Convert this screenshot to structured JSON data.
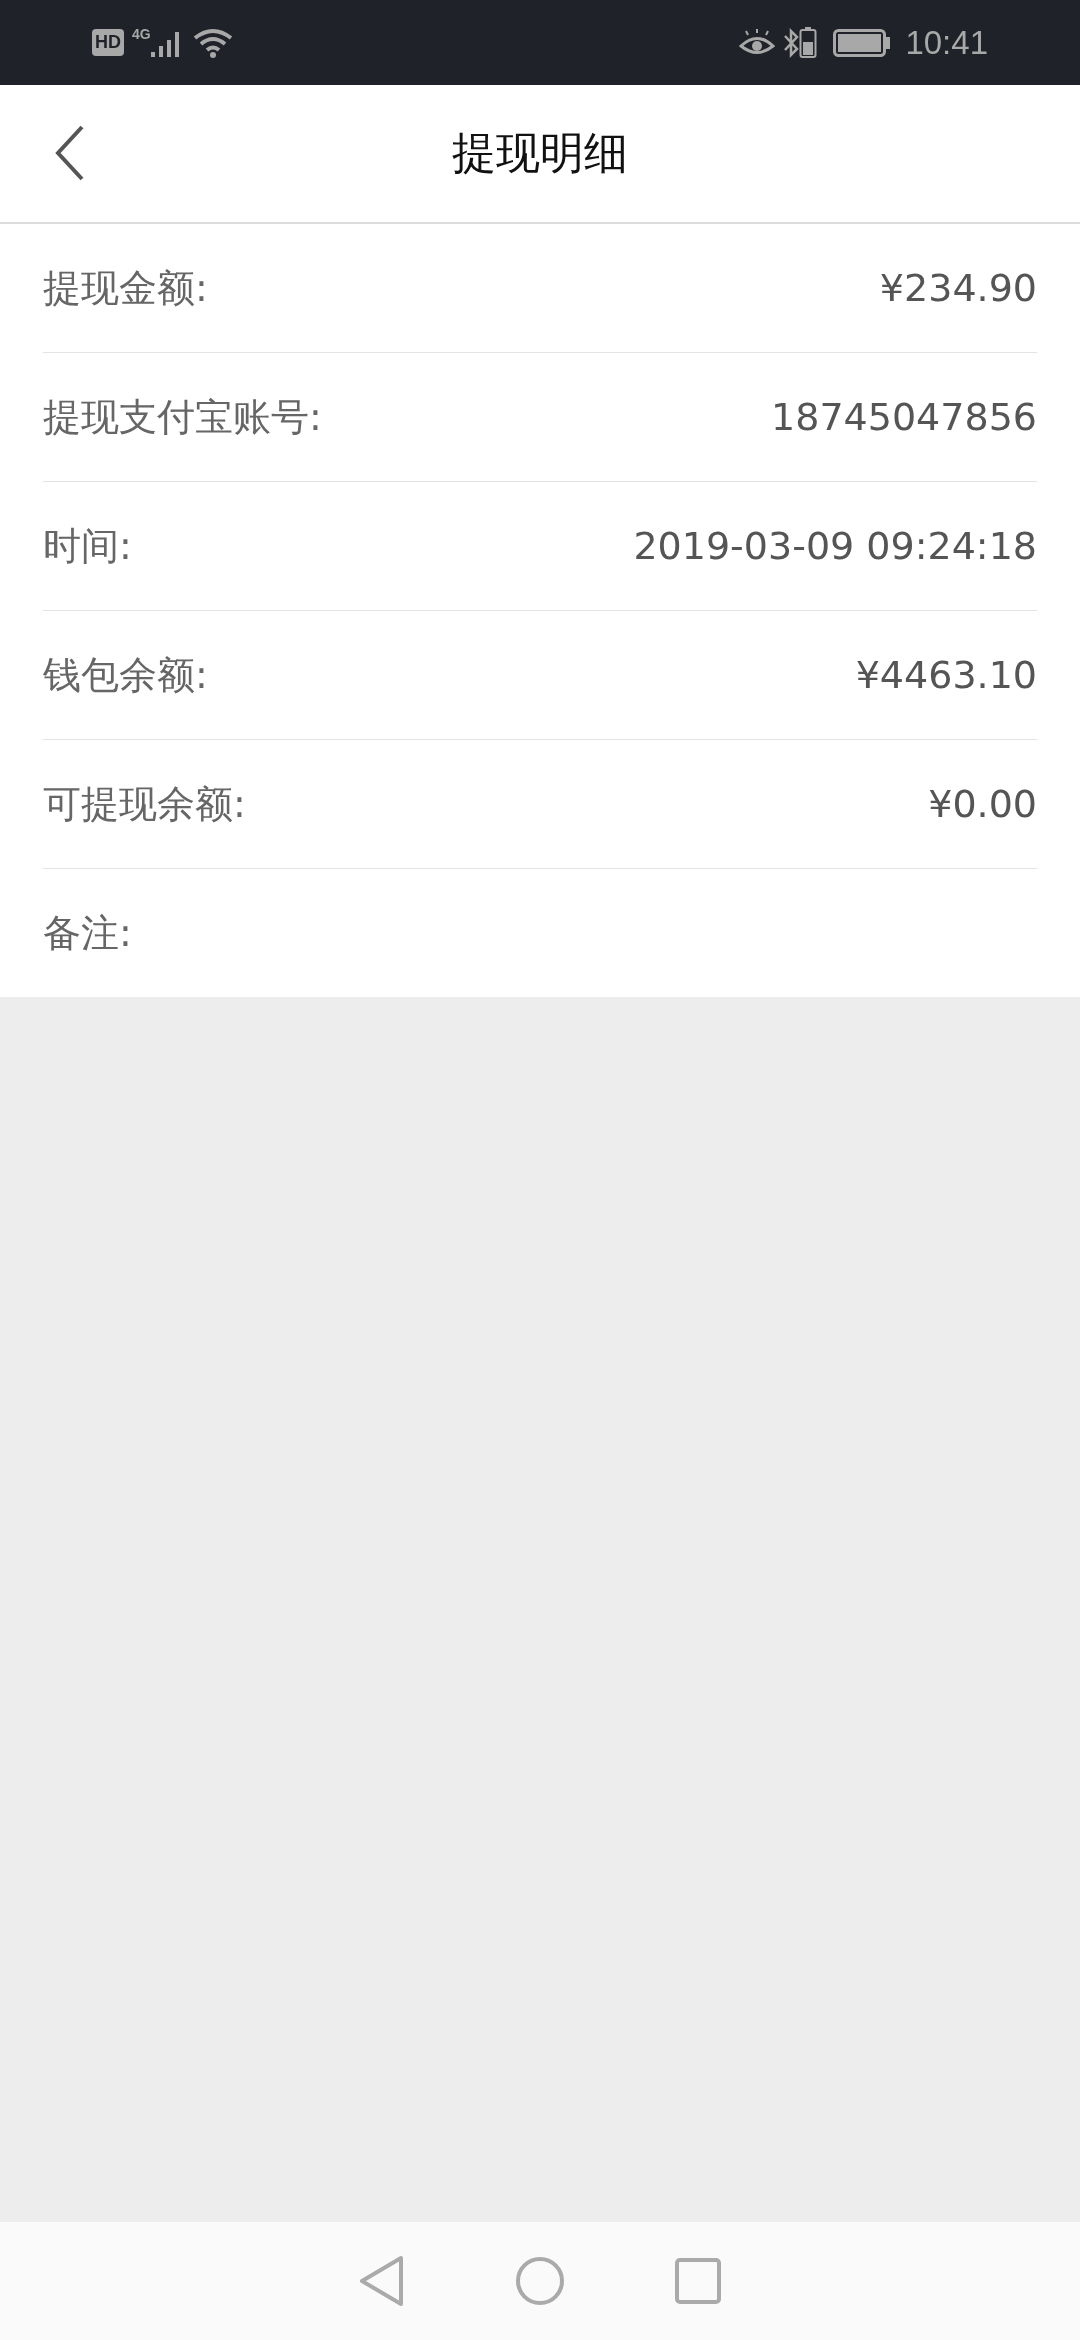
{
  "status_bar": {
    "hd": "HD",
    "network": "4G",
    "time": "10:41"
  },
  "header": {
    "title": "提现明细"
  },
  "rows": [
    {
      "label": "提现金额:",
      "value": "¥234.90"
    },
    {
      "label": "提现支付宝账号:",
      "value": "18745047856"
    },
    {
      "label": "时间:",
      "value": "2019-03-09 09:24:18"
    },
    {
      "label": "钱包余额:",
      "value": "¥4463.10"
    },
    {
      "label": "可提现余额:",
      "value": "¥0.00"
    },
    {
      "label": "备注:"
    }
  ]
}
